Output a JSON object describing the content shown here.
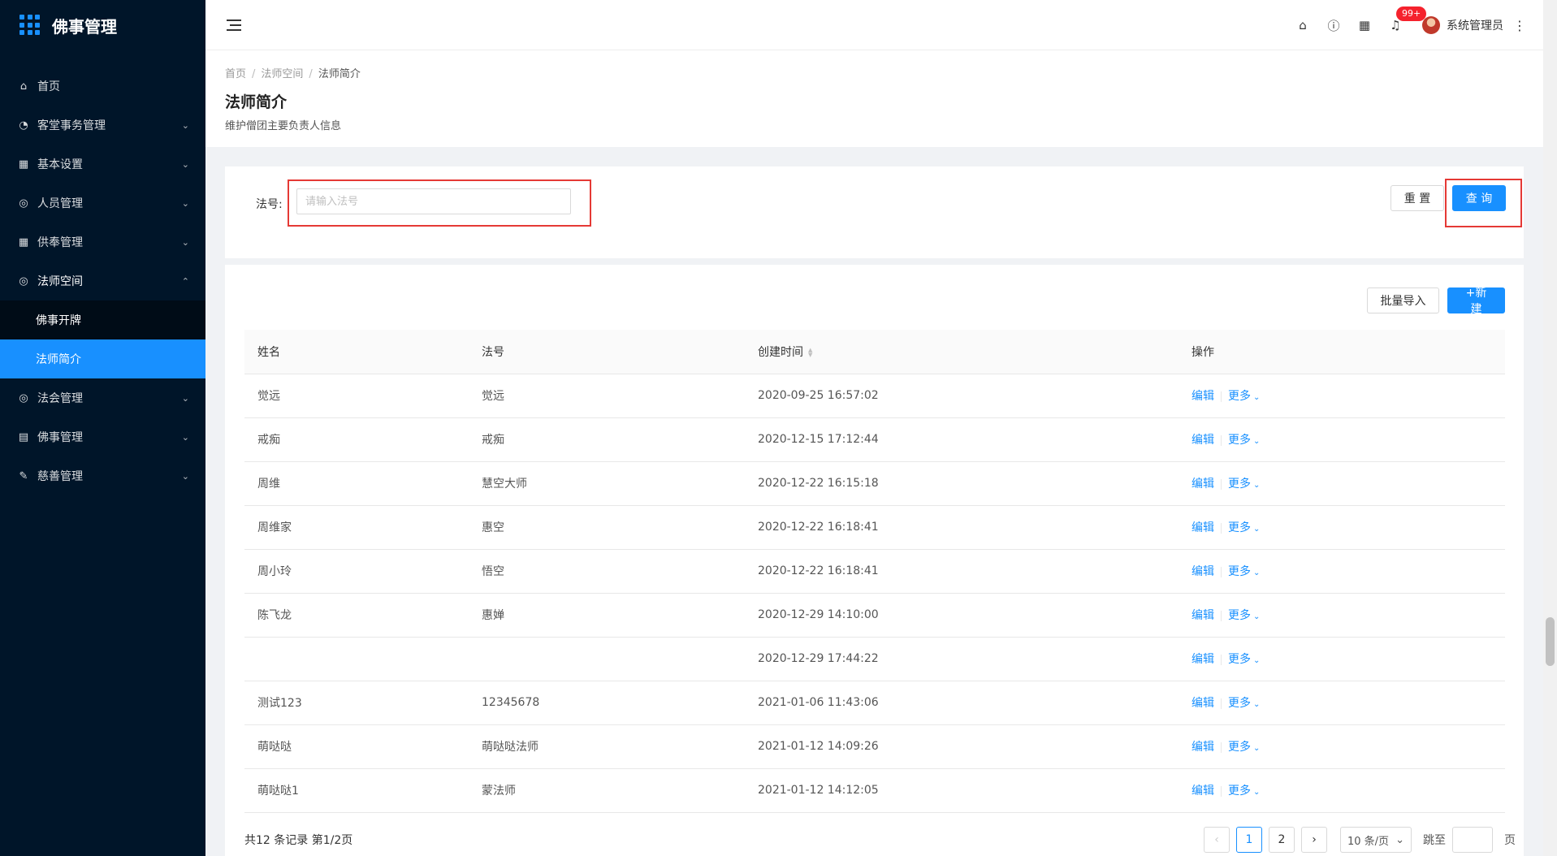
{
  "sidebar": {
    "app_title": "佛事管理",
    "items": [
      {
        "label": "首页",
        "icon": "home-icon"
      },
      {
        "label": "客堂事务管理",
        "icon": "dashboard-icon"
      },
      {
        "label": "基本设置",
        "icon": "table-icon"
      },
      {
        "label": "人员管理",
        "icon": "check-circle-icon"
      },
      {
        "label": "供奉管理",
        "icon": "table-icon"
      },
      {
        "label": "法师空间",
        "icon": "check-circle-icon"
      },
      {
        "label": "法会管理",
        "icon": "check-circle-icon"
      },
      {
        "label": "佛事管理",
        "icon": "profile-icon"
      },
      {
        "label": "慈善管理",
        "icon": "form-icon"
      }
    ],
    "submenu": [
      {
        "label": "佛事开牌"
      },
      {
        "label": "法师简介"
      }
    ]
  },
  "header": {
    "badge": "99+",
    "user_name": "系统管理员"
  },
  "page": {
    "breadcrumb": [
      "首页",
      "法师空间",
      "法师简介"
    ],
    "title": "法师简介",
    "description": "维护僧团主要负责人信息"
  },
  "search": {
    "label": "法号:",
    "placeholder": "请输入法号",
    "reset_label": "重 置",
    "query_label": "查 询"
  },
  "toolbar": {
    "import_label": "批量导入",
    "new_label": "+新建"
  },
  "table": {
    "columns": [
      "姓名",
      "法号",
      "创建时间",
      "操作"
    ],
    "rows": [
      {
        "name": "觉远",
        "dharma": "觉远",
        "created": "2020-09-25 16:57:02"
      },
      {
        "name": "戒痴",
        "dharma": "戒痴",
        "created": "2020-12-15 17:12:44"
      },
      {
        "name": "周维",
        "dharma": "慧空大师",
        "created": "2020-12-22 16:15:18"
      },
      {
        "name": "周维家",
        "dharma": "惠空",
        "created": "2020-12-22 16:18:41"
      },
      {
        "name": "周小玲",
        "dharma": "悟空",
        "created": "2020-12-22 16:18:41"
      },
      {
        "name": "陈飞龙",
        "dharma": "惠婵",
        "created": "2020-12-29 14:10:00"
      },
      {
        "name": "",
        "dharma": "",
        "created": "2020-12-29 17:44:22"
      },
      {
        "name": "测试123",
        "dharma": "12345678",
        "created": "2021-01-06 11:43:06"
      },
      {
        "name": "萌哒哒",
        "dharma": "萌哒哒法师",
        "created": "2021-01-12 14:09:26"
      },
      {
        "name": "萌哒哒1",
        "dharma": "蒙法师",
        "created": "2021-01-12 14:12:05"
      }
    ],
    "edit_label": "编辑",
    "more_label": "更多"
  },
  "pagination": {
    "total_text": "共12 条记录 第1/2页",
    "pages": [
      "1",
      "2"
    ],
    "current": "1",
    "page_size": "10 条/页",
    "jump_label": "跳至",
    "page_unit": "页"
  }
}
